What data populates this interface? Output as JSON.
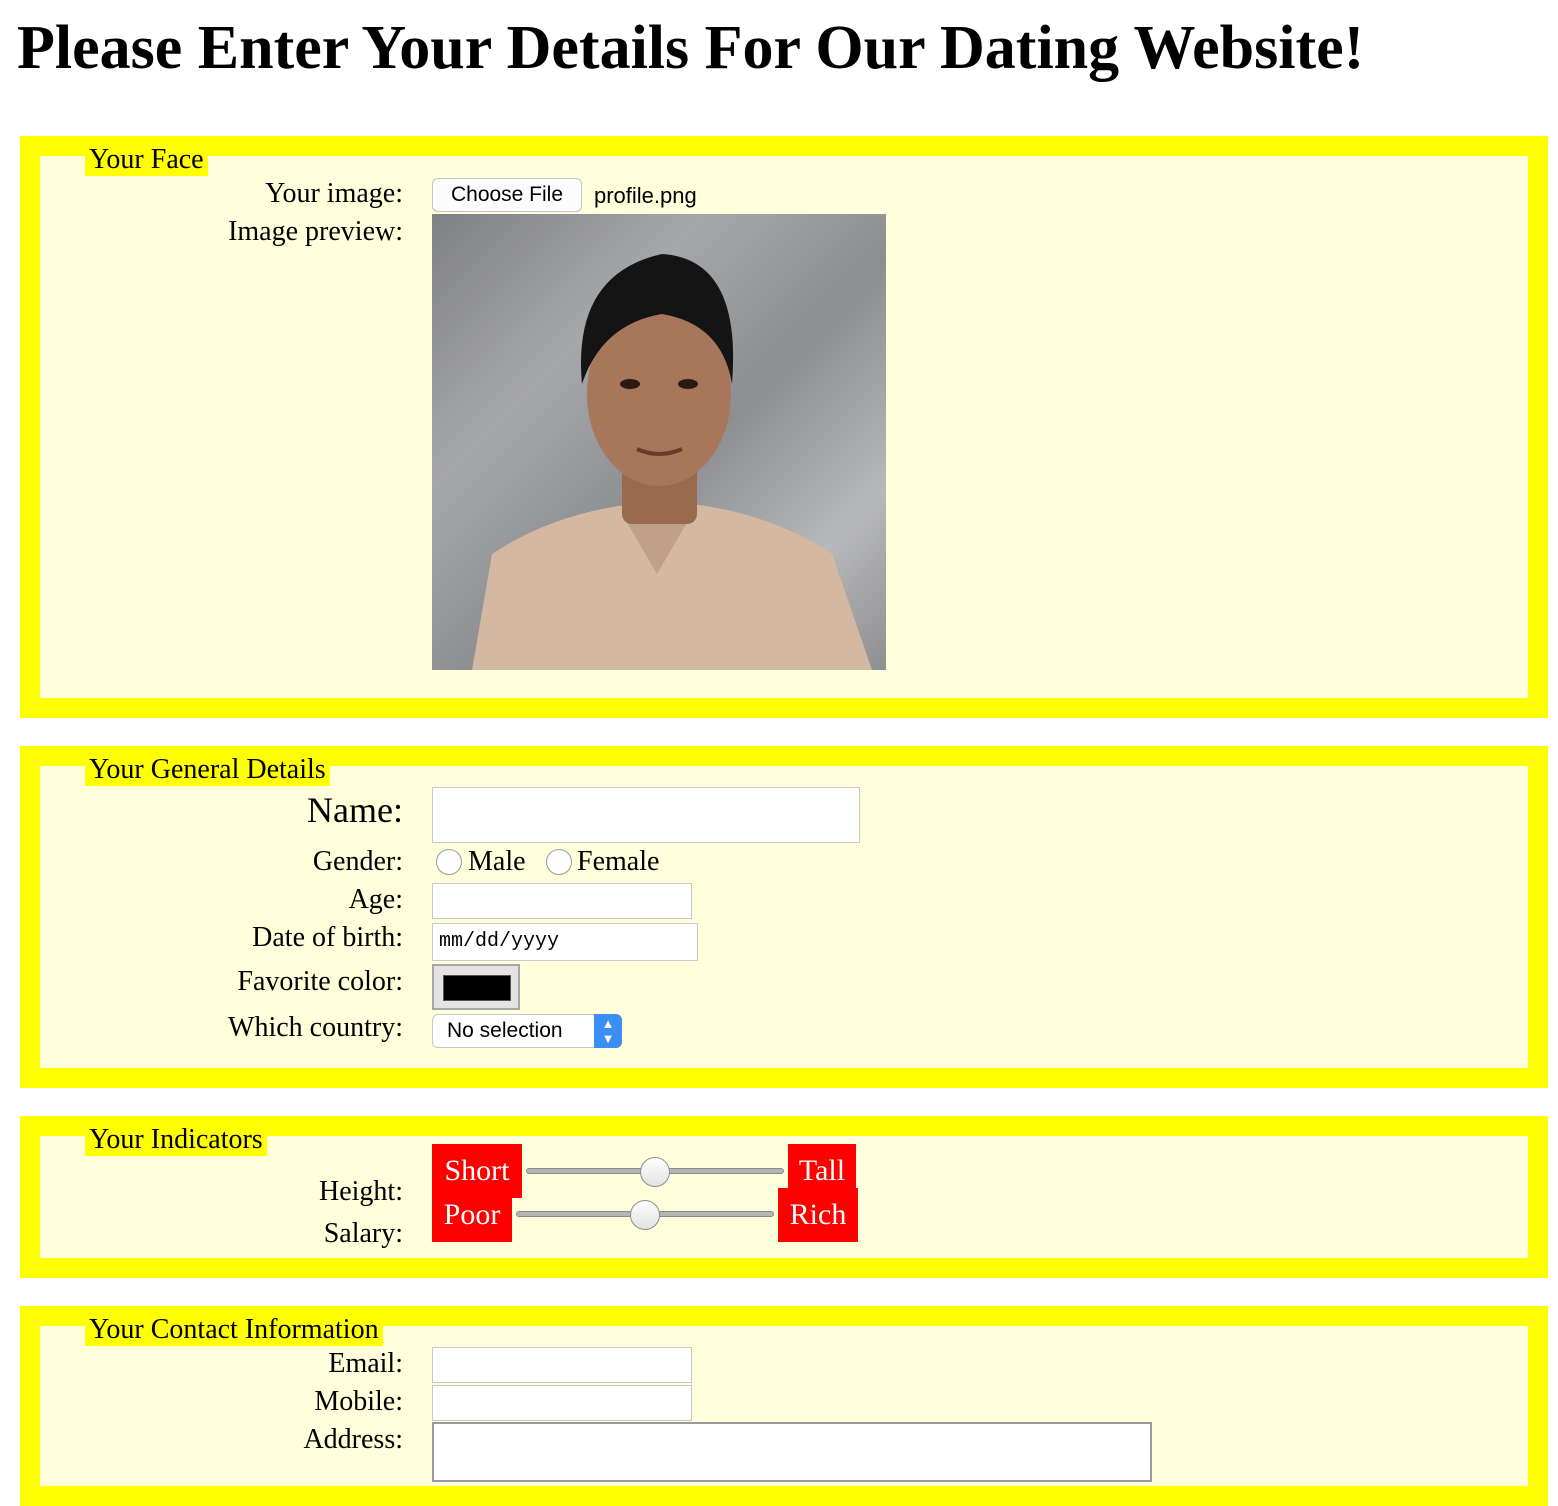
{
  "page": {
    "title": "Please Enter Your Details For Our Dating Website!"
  },
  "face": {
    "legend": "Your Face",
    "image_label": "Your image:",
    "choose_file_label": "Choose File",
    "file_name": "profile.png",
    "preview_label": "Image preview:"
  },
  "general": {
    "legend": "Your General Details",
    "name_label": "Name:",
    "name_value": "",
    "gender_label": "Gender:",
    "gender_options": [
      "Male",
      "Female"
    ],
    "age_label": "Age:",
    "age_value": "",
    "dob_label": "Date of birth:",
    "dob_placeholder": "mm/dd/yyyy",
    "color_label": "Favorite color:",
    "color_value": "#000000",
    "country_label": "Which country:",
    "country_value": "No selection"
  },
  "indicators": {
    "legend": "Your Indicators",
    "height": {
      "label": "Height:",
      "min_label": "Short",
      "max_label": "Tall",
      "value": 0.5
    },
    "salary": {
      "label": "Salary:",
      "min_label": "Poor",
      "max_label": "Rich",
      "value": 0.5
    }
  },
  "contact": {
    "legend": "Your Contact Information",
    "email_label": "Email:",
    "email_value": "",
    "mobile_label": "Mobile:",
    "mobile_value": "",
    "address_label": "Address:",
    "address_value": ""
  },
  "colors": {
    "fieldset_border": "#ffff00",
    "fieldset_bg": "#ffffdc",
    "badge": "#ff0000"
  }
}
